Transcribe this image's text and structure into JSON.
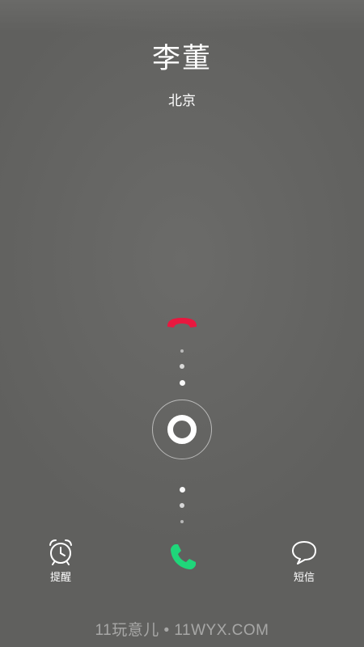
{
  "caller": {
    "name": "李董",
    "location": "北京"
  },
  "actions": {
    "decline_icon": "phone-hangup-icon",
    "answer_icon": "phone-answer-icon",
    "slider_icon": "slider-ring-icon",
    "reminder": {
      "label": "提醒",
      "icon": "alarm-clock-icon"
    },
    "message": {
      "label": "短信",
      "icon": "speech-bubble-icon"
    }
  },
  "watermark": "11玩意儿 • 11WYX.COM",
  "colors": {
    "background": "#636361",
    "decline": "#e8183f",
    "answer": "#1fd67a",
    "text": "#ffffff"
  }
}
